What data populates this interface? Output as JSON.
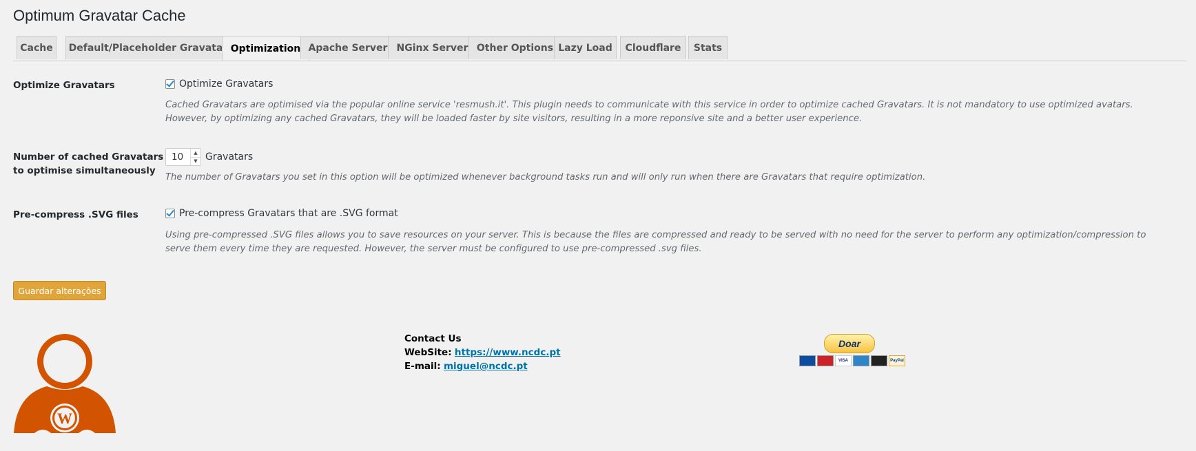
{
  "page": {
    "title": "Optimum Gravatar Cache"
  },
  "tabs": [
    {
      "label": "Cache"
    },
    {
      "label": "Default/Placeholder Gravatar"
    },
    {
      "label": "Optimization",
      "active": true
    },
    {
      "label": "Apache Server"
    },
    {
      "label": "NGinx Server"
    },
    {
      "label": "Other Options"
    },
    {
      "label": "Lazy Load"
    },
    {
      "label": "Cloudflare"
    },
    {
      "label": "Stats"
    }
  ],
  "settings": {
    "optimize": {
      "label": "Optimize Gravatars",
      "checkbox_label": "Optimize Gravatars",
      "checked": true,
      "description": "Cached Gravatars are optimised via the popular online service 'resmush.it'. This plugin needs to communicate with this service in order to optimize cached Gravatars. It is not mandatory to use optimized avatars. However, by optimizing any cached Gravatars, they will be loaded faster by site visitors, resulting in a more reponsive site and a better user experience."
    },
    "simultaneous": {
      "label_line1": "Number of cached Gravatars",
      "label_line2": "to optimise simultaneously",
      "value": "10",
      "unit": "Gravatars",
      "description": "The number of Gravatars you set in this option will be optimized whenever background tasks run and will only run when there are Gravatars that require optimization."
    },
    "precompress": {
      "label": "Pre-compress .SVG files",
      "checkbox_label": "Pre-compress Gravatars that are .SVG format",
      "checked": true,
      "description": "Using pre-compressed .SVG files allows you to save resources on your server. This is because the files are compressed and ready to be served with no need for the server to perform any optimization/compression to serve them every time they are requested. However, the server must be configured to use pre-compressed .svg files."
    }
  },
  "actions": {
    "save_label": "Guardar alterações"
  },
  "contact": {
    "heading": "Contact Us",
    "website_label": "WebSite:",
    "website_url": "https://www.ncdc.pt",
    "email_label": "E-mail:",
    "email": "miguel@ncdc.pt"
  },
  "donate": {
    "button_label": "Doar",
    "cards": [
      "Maestro",
      "MasterCard",
      "VISA",
      "Amex",
      "Discover",
      "PayPal"
    ]
  },
  "colors": {
    "logo": "#d35400",
    "save_button": "#e0a53a",
    "link": "#0073aa"
  }
}
